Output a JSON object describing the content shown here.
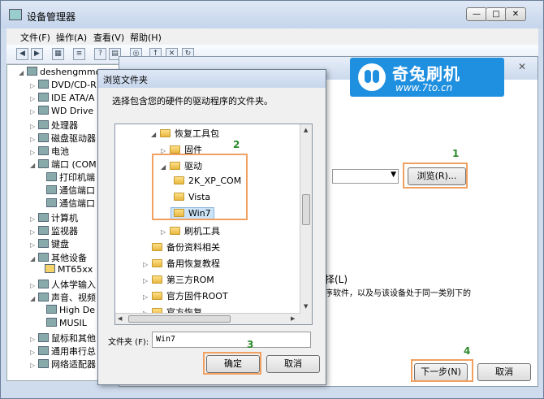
{
  "window": {
    "title": "设备管理器",
    "buttons": {
      "minimize": "—",
      "maximize": "□",
      "close": "✕"
    }
  },
  "menu": [
    "文件(F)",
    "操作(A)",
    "查看(V)",
    "帮助(H)"
  ],
  "tree": [
    "deshengmmo",
    "DVD/CD-R",
    "IDE ATA/A",
    "WD Drive",
    "处理器",
    "磁盘驱动器",
    "电池",
    "端口 (COM",
    "打印机端",
    "通信端口",
    "通信端口",
    "计算机",
    "监视器",
    "键盘",
    "其他设备",
    "MT65xx",
    "人体学输入",
    "声音、视频",
    "High De",
    "MUSIL",
    "鼠标和其他",
    "通用串行总",
    "网络适配器"
  ],
  "banner": {
    "title": "奇兔刷机",
    "url": "www.7to.cn"
  },
  "wizard": {
    "close": "✕",
    "browse_button": "浏览(R)...",
    "text_heading": "择(L)",
    "text_body": "序软件，以及与该设备处于同一类别下的",
    "next_button": "下一步(N)",
    "cancel_button": "取消"
  },
  "browse": {
    "title": "浏览文件夹",
    "description": "选择包含您的硬件的驱动程序的文件夹。",
    "folders": [
      {
        "label": "恢复工具包",
        "arrow": "◢"
      },
      {
        "label": "固件",
        "arrow": "▷"
      },
      {
        "label": "驱动",
        "arrow": "◢"
      },
      {
        "label": "2K_XP_COM",
        "arrow": ""
      },
      {
        "label": "Vista",
        "arrow": ""
      },
      {
        "label": "Win7",
        "arrow": ""
      },
      {
        "label": "刷机工具",
        "arrow": "▷"
      },
      {
        "label": "备份资料相关",
        "arrow": ""
      },
      {
        "label": "备用恢复教程",
        "arrow": "▷"
      },
      {
        "label": "第三方ROM",
        "arrow": "▷"
      },
      {
        "label": "官方固件ROOT",
        "arrow": "▷"
      },
      {
        "label": "官方恢复",
        "arrow": "▷"
      }
    ],
    "folder_label": "文件夹 (F):",
    "folder_value": "Win7",
    "ok_button": "确定",
    "cancel_button": "取消"
  },
  "steps": [
    "1",
    "2",
    "3",
    "4"
  ],
  "colors": {
    "highlight": "#f0a060",
    "step_number": "#2a8a2a",
    "banner": "#1f8fe0"
  }
}
